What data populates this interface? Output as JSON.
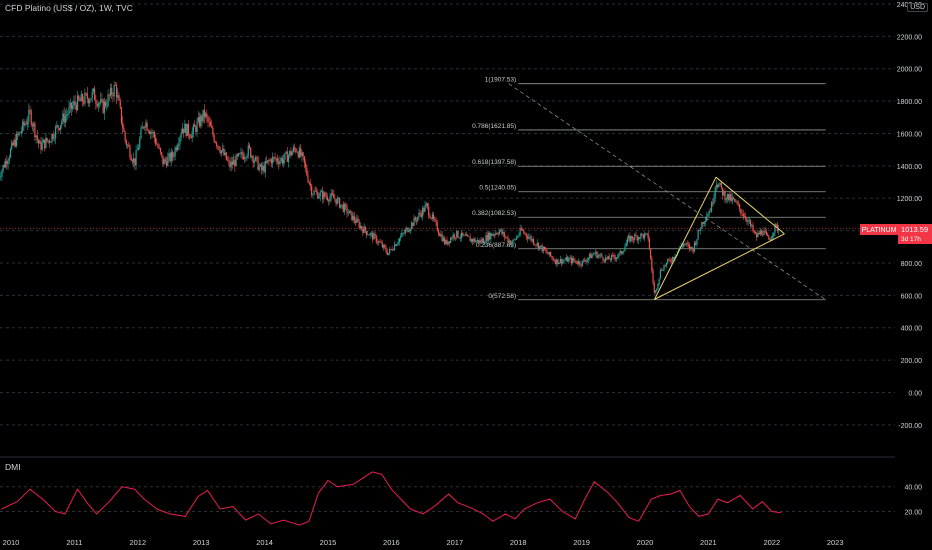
{
  "header": {
    "symbol_title": "CFD Platino (US$ / OZ), 1W, TVC",
    "currency": "USD"
  },
  "price_tag": {
    "symbol": "PLATINUM",
    "price": "1013.59",
    "countdown": "3d 17h",
    "value": 1013.59
  },
  "indicator": {
    "label": "DMI"
  },
  "colors": {
    "background": "#000000",
    "up_candle": "#26a69a",
    "down_candle": "#ef5350",
    "fib_line": "#c9d1c9",
    "triangle": "#e8d36b",
    "trend_dashed": "#8a8a8a",
    "dmi_line": "#e91e4f",
    "price_tag": "#f23645",
    "grid": "#2a2e39",
    "axis_text": "#d1d4dc"
  },
  "chart_data": {
    "type": "candlestick",
    "title": "CFD Platino (US$ / OZ), 1W, TVC",
    "x_axis": {
      "ticks": [
        "2010",
        "2011",
        "2012",
        "2013",
        "2014",
        "2015",
        "2016",
        "2017",
        "2018",
        "2019",
        "2020",
        "2021",
        "2022",
        "2023"
      ]
    },
    "y_axis": {
      "range": [
        -300,
        2400
      ],
      "ticks": [
        "2400.00",
        "2200.00",
        "2000.00",
        "1800.00",
        "1600.00",
        "1400.00",
        "1200.00",
        "1000.00",
        "800.00",
        "600.00",
        "400.00",
        "200.00",
        "0.00",
        "-200.00"
      ],
      "tick_values": [
        2400,
        2200,
        2000,
        1800,
        1600,
        1400,
        1200,
        1000,
        800,
        600,
        400,
        200,
        0,
        -200
      ]
    },
    "price_path": [
      [
        2009.8,
        1330
      ],
      [
        2010.05,
        1540
      ],
      [
        2010.3,
        1720
      ],
      [
        2010.45,
        1520
      ],
      [
        2010.6,
        1560
      ],
      [
        2010.8,
        1680
      ],
      [
        2011.0,
        1780
      ],
      [
        2011.1,
        1800
      ],
      [
        2011.3,
        1840
      ],
      [
        2011.45,
        1760
      ],
      [
        2011.6,
        1860
      ],
      [
        2011.65,
        1890
      ],
      [
        2011.8,
        1560
      ],
      [
        2011.95,
        1420
      ],
      [
        2012.1,
        1680
      ],
      [
        2012.25,
        1590
      ],
      [
        2012.4,
        1420
      ],
      [
        2012.55,
        1460
      ],
      [
        2012.7,
        1640
      ],
      [
        2012.85,
        1600
      ],
      [
        2013.05,
        1720
      ],
      [
        2013.2,
        1580
      ],
      [
        2013.45,
        1400
      ],
      [
        2013.6,
        1450
      ],
      [
        2013.75,
        1500
      ],
      [
        2013.95,
        1370
      ],
      [
        2014.1,
        1440
      ],
      [
        2014.3,
        1440
      ],
      [
        2014.5,
        1510
      ],
      [
        2014.6,
        1440
      ],
      [
        2014.75,
        1240
      ],
      [
        2014.9,
        1220
      ],
      [
        2015.1,
        1200
      ],
      [
        2015.3,
        1120
      ],
      [
        2015.55,
        1010
      ],
      [
        2015.75,
        950
      ],
      [
        2015.95,
        860
      ],
      [
        2016.1,
        940
      ],
      [
        2016.3,
        1030
      ],
      [
        2016.55,
        1150
      ],
      [
        2016.65,
        1070
      ],
      [
        2016.85,
        920
      ],
      [
        2017.0,
        980
      ],
      [
        2017.2,
        950
      ],
      [
        2017.4,
        930
      ],
      [
        2017.55,
        970
      ],
      [
        2017.7,
        1000
      ],
      [
        2017.9,
        920
      ],
      [
        2018.05,
        1000
      ],
      [
        2018.2,
        950
      ],
      [
        2018.4,
        880
      ],
      [
        2018.6,
        810
      ],
      [
        2018.8,
        820
      ],
      [
        2019.0,
        800
      ],
      [
        2019.2,
        860
      ],
      [
        2019.4,
        820
      ],
      [
        2019.6,
        850
      ],
      [
        2019.75,
        950
      ],
      [
        2019.95,
        970
      ],
      [
        2020.05,
        960
      ],
      [
        2020.15,
        600
      ],
      [
        2020.25,
        760
      ],
      [
        2020.45,
        840
      ],
      [
        2020.6,
        920
      ],
      [
        2020.75,
        880
      ],
      [
        2020.9,
        1050
      ],
      [
        2021.05,
        1150
      ],
      [
        2021.12,
        1310
      ],
      [
        2021.25,
        1220
      ],
      [
        2021.4,
        1180
      ],
      [
        2021.6,
        1080
      ],
      [
        2021.75,
        960
      ],
      [
        2021.85,
        1000
      ],
      [
        2021.95,
        940
      ],
      [
        2022.05,
        1020
      ],
      [
        2022.12,
        1013.59
      ]
    ],
    "fibonacci": {
      "x_start": 2018.0,
      "x_end": 2022.85,
      "levels": [
        {
          "label": "1(1907.53)",
          "value": 1907.53
        },
        {
          "label": "0.786(1621.85)",
          "value": 1621.85
        },
        {
          "label": "0.618(1397.58)",
          "value": 1397.58
        },
        {
          "label": "0.5(1240.05)",
          "value": 1240.05
        },
        {
          "label": "0.382(1082.53)",
          "value": 1082.53
        },
        {
          "label": "0.236(887.63)",
          "value": 887.63
        },
        {
          "label": "0(572.58)",
          "value": 572.58
        }
      ]
    },
    "trendline_dashed": {
      "from": [
        2017.85,
        1907.53
      ],
      "to": [
        2022.85,
        572.58
      ]
    },
    "triangle": {
      "points": [
        [
          2020.15,
          575
        ],
        [
          2021.12,
          1330
        ],
        [
          2022.2,
          980
        ]
      ]
    },
    "dmi": {
      "ticks": [
        "40.00",
        "20.00"
      ],
      "tick_values": [
        40,
        20
      ],
      "range": [
        5,
        60
      ],
      "values": [
        [
          2009.85,
          22
        ],
        [
          2010.1,
          28
        ],
        [
          2010.3,
          38
        ],
        [
          2010.5,
          30
        ],
        [
          2010.7,
          20
        ],
        [
          2010.85,
          18
        ],
        [
          2011.05,
          38
        ],
        [
          2011.2,
          27
        ],
        [
          2011.35,
          18
        ],
        [
          2011.55,
          28
        ],
        [
          2011.75,
          40
        ],
        [
          2011.95,
          38
        ],
        [
          2012.1,
          30
        ],
        [
          2012.3,
          22
        ],
        [
          2012.5,
          18
        ],
        [
          2012.75,
          16
        ],
        [
          2012.95,
          32
        ],
        [
          2013.1,
          37
        ],
        [
          2013.3,
          22
        ],
        [
          2013.5,
          24
        ],
        [
          2013.7,
          13
        ],
        [
          2013.9,
          18
        ],
        [
          2014.1,
          10
        ],
        [
          2014.3,
          13
        ],
        [
          2014.55,
          9
        ],
        [
          2014.7,
          12
        ],
        [
          2014.85,
          35
        ],
        [
          2015.0,
          45
        ],
        [
          2015.15,
          40
        ],
        [
          2015.4,
          42
        ],
        [
          2015.55,
          47
        ],
        [
          2015.7,
          52
        ],
        [
          2015.85,
          50
        ],
        [
          2016.0,
          38
        ],
        [
          2016.15,
          30
        ],
        [
          2016.3,
          22
        ],
        [
          2016.5,
          18
        ],
        [
          2016.7,
          25
        ],
        [
          2016.9,
          34
        ],
        [
          2017.05,
          27
        ],
        [
          2017.25,
          23
        ],
        [
          2017.45,
          18
        ],
        [
          2017.6,
          12
        ],
        [
          2017.8,
          18
        ],
        [
          2017.95,
          14
        ],
        [
          2018.1,
          22
        ],
        [
          2018.3,
          27
        ],
        [
          2018.5,
          30
        ],
        [
          2018.7,
          20
        ],
        [
          2018.9,
          14
        ],
        [
          2019.05,
          30
        ],
        [
          2019.2,
          44
        ],
        [
          2019.4,
          36
        ],
        [
          2019.55,
          28
        ],
        [
          2019.75,
          15
        ],
        [
          2019.9,
          12
        ],
        [
          2020.1,
          30
        ],
        [
          2020.25,
          33
        ],
        [
          2020.4,
          34
        ],
        [
          2020.55,
          37
        ],
        [
          2020.7,
          24
        ],
        [
          2020.85,
          16
        ],
        [
          2021.0,
          18
        ],
        [
          2021.15,
          30
        ],
        [
          2021.3,
          27
        ],
        [
          2021.5,
          33
        ],
        [
          2021.7,
          22
        ],
        [
          2021.85,
          28
        ],
        [
          2022.0,
          20
        ],
        [
          2022.15,
          19
        ]
      ]
    }
  }
}
